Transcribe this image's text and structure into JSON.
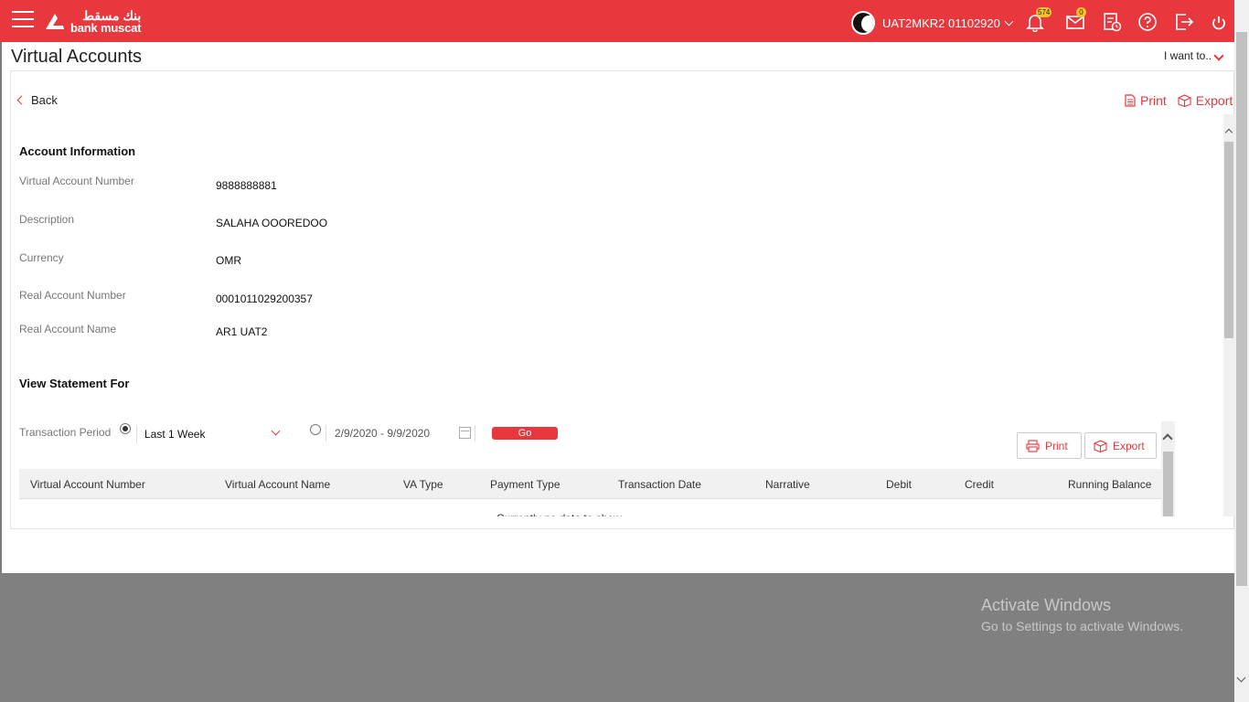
{
  "header": {
    "logo_arabic": "بنك مسقط",
    "logo_english": "bank muscat",
    "user_name": "UAT2MKR2 01102920",
    "notifications_count": "574",
    "messages_count": "0"
  },
  "page": {
    "title": "Virtual Accounts",
    "i_want_to": "I want to..",
    "back_label": "Back",
    "print_label": "Print",
    "export_label": "Export"
  },
  "account_info": {
    "section_title": "Account Information",
    "fields": [
      {
        "label": "Virtual Account Number",
        "value": "9888888881"
      },
      {
        "label": "Description",
        "value": "SALAHA OOOREDOO"
      },
      {
        "label": "Currency",
        "value": "OMR"
      },
      {
        "label": "Real Account Number",
        "value": "0001011029200357"
      },
      {
        "label": "Real Account Name",
        "value": "AR1 UAT2"
      }
    ]
  },
  "statement": {
    "section_title": "View Statement For",
    "period_label": "Transaction Period",
    "period_selected": "Last 1 Week",
    "date_range": "2/9/2020 - 9/9/2020",
    "go_label": "Go",
    "print_label": "Print",
    "export_label": "Export",
    "columns": [
      "Virtual Account Number",
      "Virtual Account Name",
      "VA Type",
      "Payment Type",
      "Transaction Date",
      "Narrative",
      "Debit",
      "Credit",
      "Running Balance"
    ],
    "truncated_row_text": "Currently no data to show"
  },
  "windows_watermark": {
    "line1": "Activate Windows",
    "line2": "Go to Settings to activate Windows."
  },
  "colors": {
    "brand_red": "#e8373d",
    "badge_yellow": "#f7c326"
  }
}
